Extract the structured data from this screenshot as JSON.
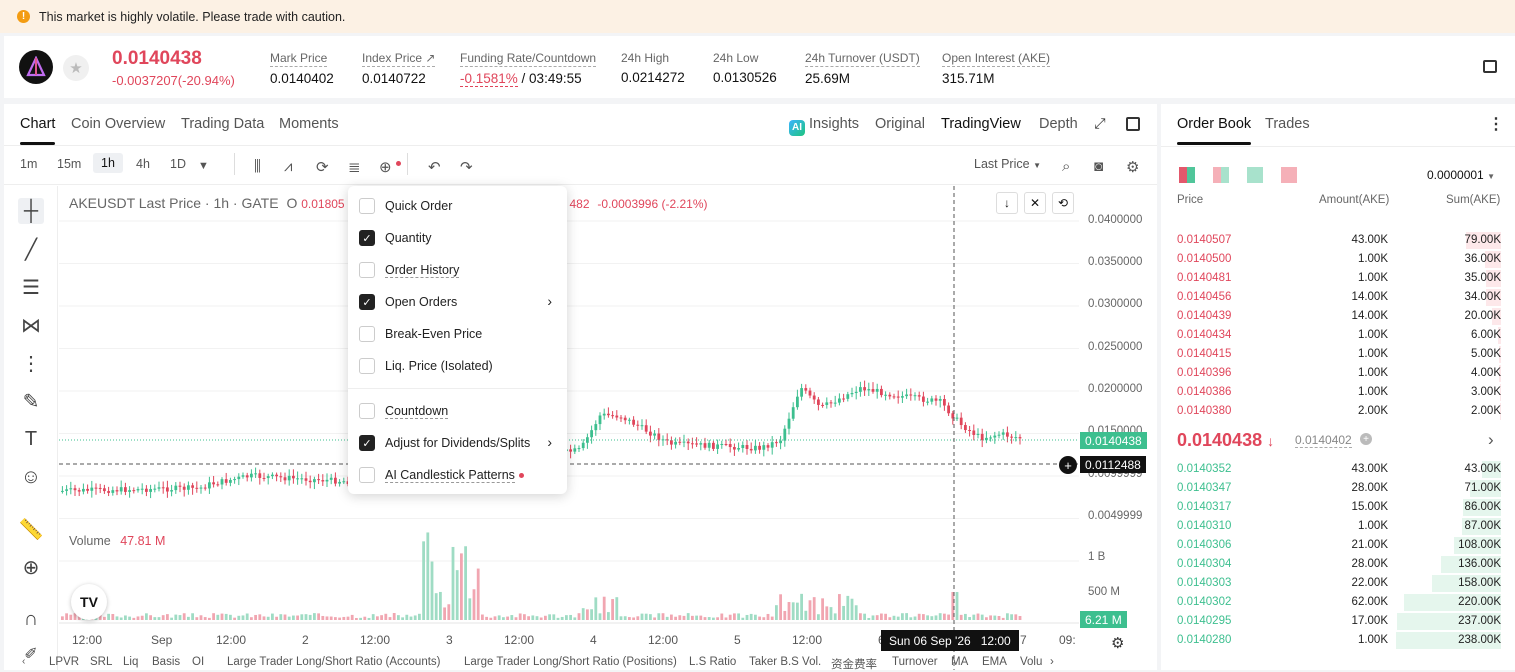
{
  "banner": {
    "icon": "info-icon",
    "text": "This market is highly volatile. Please trade with caution."
  },
  "ticker": {
    "last_price": "0.0140438",
    "change": "-0.0037207(-20.94%)",
    "stats": [
      {
        "label": "Mark Price",
        "value": "0.0140402"
      },
      {
        "label": "Index Price ↗",
        "value": "0.0140722"
      },
      {
        "label": "Funding Rate/Countdown",
        "value_neg": "-0.1581%",
        "value": " / 03:49:55"
      },
      {
        "label": "24h High",
        "value": "0.0214272"
      },
      {
        "label": "24h Low",
        "value": "0.0130526"
      },
      {
        "label": "24h Turnover (USDT)",
        "value": "25.69M"
      },
      {
        "label": "Open Interest (AKE)",
        "value": "315.71M"
      }
    ]
  },
  "chart_tabs": {
    "chart": "Chart",
    "overview": "Coin Overview",
    "trading_data": "Trading Data",
    "moments": "Moments",
    "insights": "Insights",
    "original": "Original",
    "tradingview": "TradingView",
    "depth": "Depth"
  },
  "toolbar": {
    "tf": [
      "1m",
      "15m",
      "1h",
      "4h",
      "1D"
    ],
    "price_type": "Last Price"
  },
  "legend": {
    "title": "AKEUSDT Last Price · 1h · GATE",
    "o_prefix": "O",
    "o_value": "0.01805",
    "tail": "482",
    "change": "-0.0003996 (-2.21%)"
  },
  "volume_legend": {
    "label": "Volume",
    "value": "47.81 M"
  },
  "menu": {
    "items": [
      {
        "label": "Quick Order",
        "checked": false
      },
      {
        "label": "Quantity",
        "checked": true
      },
      {
        "label": "Order History",
        "checked": false
      },
      {
        "label": "Open Orders",
        "checked": true,
        "submenu": true
      },
      {
        "label": "Break-Even Price",
        "checked": false
      },
      {
        "label": "Liq. Price (Isolated)",
        "checked": false
      },
      {
        "label": "Countdown",
        "checked": false
      },
      {
        "label": "Adjust for Dividends/Splits",
        "checked": true,
        "submenu": true
      },
      {
        "label": "AI Candlestick Patterns",
        "checked": false,
        "dot": true
      }
    ]
  },
  "price_axis": [
    "0.0400000",
    "0.0350000",
    "0.0300000",
    "0.0250000",
    "0.0200000",
    "0.0150000",
    "0.0099999",
    "0.0049999"
  ],
  "price_tags": {
    "last": "0.0140438",
    "cursor": "0.0112488"
  },
  "volume_axis": [
    "1 B",
    "500 M"
  ],
  "volume_tag": "6.21 M",
  "time_axis": [
    "12:00",
    "Sep",
    "12:00",
    "2",
    "12:00",
    "3",
    "12:00",
    "4",
    "12:00",
    "5",
    "12:00",
    "6",
    "7",
    "09:"
  ],
  "crosshair_time": "Sun 06 Sep '26   12:00",
  "bottom_bar": [
    "LPVR",
    "SRL",
    "Liq",
    "Basis",
    "OI",
    "Large Trader Long/Short Ratio (Accounts)",
    "Large Trader Long/Short Ratio (Positions)",
    "L.S Ratio",
    "Taker B.S Vol.",
    "资金费率",
    "Turnover",
    "MA",
    "EMA",
    "Volu"
  ],
  "order_book": {
    "tabs": [
      "Order Book",
      "Trades"
    ],
    "precision": "0.0000001",
    "headers": [
      "Price",
      "Amount(AKE)",
      "Sum(AKE)"
    ],
    "asks": [
      {
        "price": "0.0140507",
        "amount": "43.00K",
        "sum": "79.00K",
        "depth": 0.33
      },
      {
        "price": "0.0140500",
        "amount": "1.00K",
        "sum": "36.00K",
        "depth": 0.15
      },
      {
        "price": "0.0140481",
        "amount": "1.00K",
        "sum": "35.00K",
        "depth": 0.147
      },
      {
        "price": "0.0140456",
        "amount": "14.00K",
        "sum": "34.00K",
        "depth": 0.143
      },
      {
        "price": "0.0140439",
        "amount": "14.00K",
        "sum": "20.00K",
        "depth": 0.084
      },
      {
        "price": "0.0140434",
        "amount": "1.00K",
        "sum": "6.00K",
        "depth": 0.025
      },
      {
        "price": "0.0140415",
        "amount": "1.00K",
        "sum": "5.00K",
        "depth": 0.021
      },
      {
        "price": "0.0140396",
        "amount": "1.00K",
        "sum": "4.00K",
        "depth": 0.017
      },
      {
        "price": "0.0140386",
        "amount": "1.00K",
        "sum": "3.00K",
        "depth": 0.013
      },
      {
        "price": "0.0140380",
        "amount": "2.00K",
        "sum": "2.00K",
        "depth": 0.008
      }
    ],
    "mid_price": "0.0140438",
    "mid_mark": "0.0140402",
    "bids": [
      {
        "price": "0.0140352",
        "amount": "43.00K",
        "sum": "43.00K",
        "depth": 0.18
      },
      {
        "price": "0.0140347",
        "amount": "28.00K",
        "sum": "71.00K",
        "depth": 0.3
      },
      {
        "price": "0.0140317",
        "amount": "15.00K",
        "sum": "86.00K",
        "depth": 0.36
      },
      {
        "price": "0.0140310",
        "amount": "1.00K",
        "sum": "87.00K",
        "depth": 0.37
      },
      {
        "price": "0.0140306",
        "amount": "21.00K",
        "sum": "108.00K",
        "depth": 0.45
      },
      {
        "price": "0.0140304",
        "amount": "28.00K",
        "sum": "136.00K",
        "depth": 0.57
      },
      {
        "price": "0.0140303",
        "amount": "22.00K",
        "sum": "158.00K",
        "depth": 0.66
      },
      {
        "price": "0.0140302",
        "amount": "62.00K",
        "sum": "220.00K",
        "depth": 0.92
      },
      {
        "price": "0.0140295",
        "amount": "17.00K",
        "sum": "237.00K",
        "depth": 0.99
      },
      {
        "price": "0.0140280",
        "amount": "1.00K",
        "sum": "238.00K",
        "depth": 1.0
      }
    ]
  },
  "colors": {
    "up": "#3dbf8f",
    "down": "#e0465b",
    "ask_bg": "#fde8ea",
    "bid_bg": "#e5f6ed"
  }
}
